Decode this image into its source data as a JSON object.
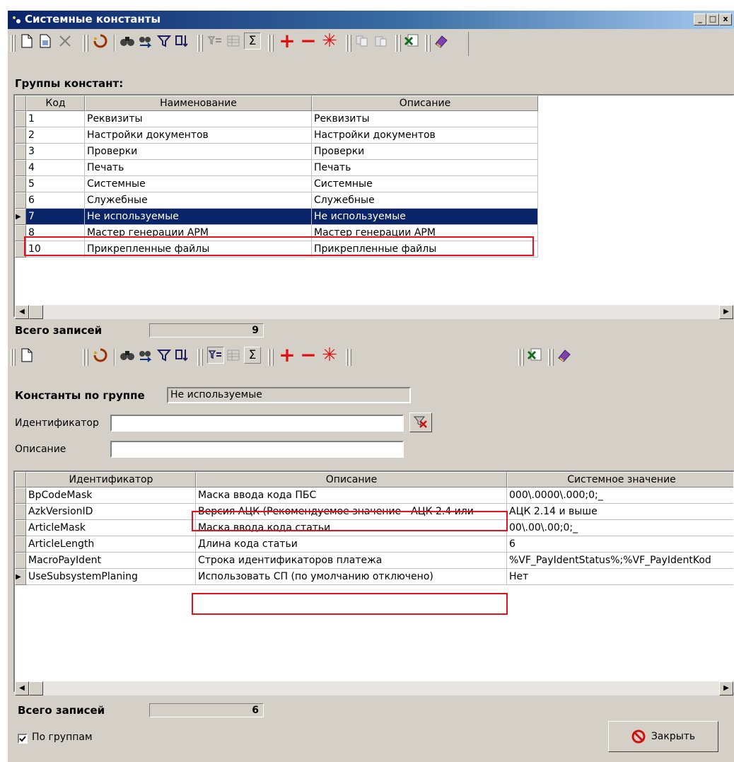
{
  "window": {
    "title": "Системные константы",
    "controls": [
      "_",
      "□",
      "x"
    ]
  },
  "toolbar_icons": [
    "new-doc-icon",
    "copy-doc-icon",
    "delete-icon",
    "refresh-icon",
    "find-icon",
    "find-next-icon",
    "filter-icon",
    "sort-icon",
    "filter-toggle-icon",
    "group-icon",
    "sum-icon",
    "plus-icon",
    "minus-icon",
    "asterisk-icon",
    "copy-icon",
    "paste-icon",
    "excel-icon",
    "book-icon"
  ],
  "groups": {
    "heading": "Группы констант:",
    "columns": [
      "Код",
      "Наименование",
      "Описание"
    ],
    "rows": [
      {
        "code": "1",
        "name": "Реквизиты",
        "desc": "Реквизиты"
      },
      {
        "code": "2",
        "name": "Настройки документов",
        "desc": "Настройки документов"
      },
      {
        "code": "3",
        "name": "Проверки",
        "desc": "Проверки"
      },
      {
        "code": "4",
        "name": "Печать",
        "desc": "Печать"
      },
      {
        "code": "5",
        "name": "Системные",
        "desc": "Системные"
      },
      {
        "code": "6",
        "name": "Служебные",
        "desc": "Служебные"
      },
      {
        "code": "7",
        "name": "Не используемые",
        "desc": "Не используемые"
      },
      {
        "code": "8",
        "name": "Мастер генерации АРМ",
        "desc": "Мастер генерации АРМ"
      },
      {
        "code": "10",
        "name": "Прикрепленные файлы",
        "desc": "Прикрепленные файлы"
      }
    ],
    "selected_index": 6,
    "total_label": "Всего записей",
    "total_value": "9"
  },
  "constants": {
    "group_label": "Константы по группе",
    "group_value": "Не используемые",
    "filter": {
      "id_label": "Идентификатор",
      "id_value": "",
      "desc_label": "Описание",
      "desc_value": ""
    },
    "columns": [
      "Идентификатор",
      "Описание",
      "Системное значение"
    ],
    "rows": [
      {
        "id": "BpCodeMask",
        "desc": "Маска ввода кода ПБС",
        "value": "000\\.0000\\.000;0;_"
      },
      {
        "id": "AzkVersionID",
        "desc": "Версия АЦК (Рекомендуемое значение - АЦК 2.4 или",
        "value": "АЦК 2.14 и выше"
      },
      {
        "id": "ArticleMask",
        "desc": "Маска ввода кода статьи",
        "value": "00\\.00\\.00;0;_"
      },
      {
        "id": "ArticleLength",
        "desc": "Длина кода статьи",
        "value": "6"
      },
      {
        "id": "MacroPayIdent",
        "desc": "Строка идентификаторов платежа",
        "value": "%VF_PayIdentStatus%;%VF_PayIdentKod"
      },
      {
        "id": "UseSubsystemPlaning",
        "desc": "Использовать СП (по умолчанию отключено)",
        "value": "Нет"
      }
    ],
    "current_index": 5,
    "total_label": "Всего записей",
    "total_value": "6"
  },
  "footer": {
    "checkbox_label": "По группам",
    "checkbox_checked": true,
    "close_label": "Закрыть"
  },
  "colors": {
    "window_bg": "#d4d0c8",
    "selection": "#0a246a",
    "highlight_box": "#e8111b"
  }
}
